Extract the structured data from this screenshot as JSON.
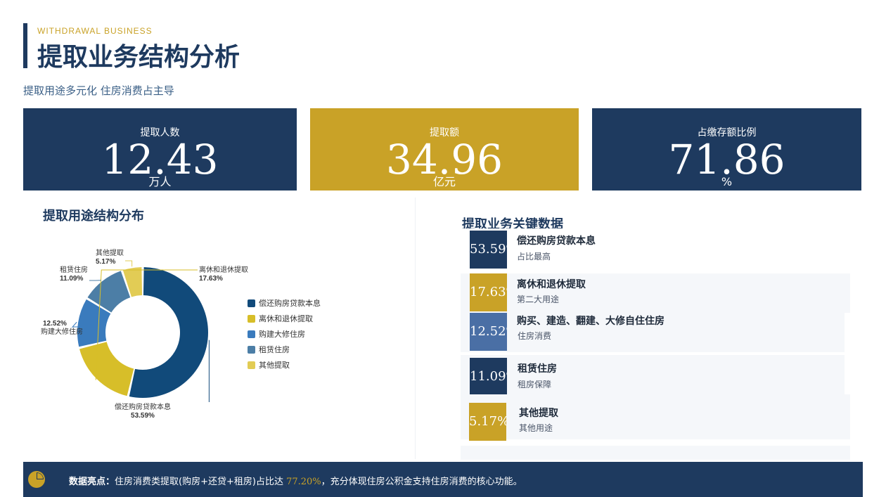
{
  "header": {
    "eyebrow": "WITHDRAWAL BUSINESS",
    "title": "提取业务结构分析",
    "subtitle": "提取用途多元化 住房消费占主导"
  },
  "kpis": [
    {
      "label": "提取人数",
      "value": "12.43",
      "unit": "万人",
      "color": "#1e3a5f"
    },
    {
      "label": "提取额",
      "value": "34.96",
      "unit": "亿元",
      "color": "#c9a227"
    },
    {
      "label": "占缴存额比例",
      "value": "71.86",
      "unit": "%",
      "color": "#1e3a5f"
    }
  ],
  "structure": {
    "title": "提取用途结构分布"
  },
  "chart_data": {
    "type": "pie",
    "variant": "donut",
    "categories": [
      "偿还购房贷款本息",
      "离休和退休提取",
      "购建大修住房",
      "租赁住房",
      "其他提取"
    ],
    "values": [
      53.59,
      17.63,
      12.52,
      11.09,
      5.17
    ],
    "value_labels": [
      "53.59%",
      "17.63%",
      "12.52%",
      "11.09%",
      "5.17%"
    ],
    "colors": [
      "#114a7a",
      "#d7be29",
      "#3a7bbd",
      "#4c7ea6",
      "#e2cc55"
    ],
    "slice_labels": [
      {
        "name": "偿还购房贷款本息",
        "value": "53.59%"
      },
      {
        "name": "离休和退休提取",
        "value": "17.63%"
      },
      {
        "name": "购建大修住房",
        "value": "12.52%"
      },
      {
        "name": "租赁住房",
        "value": "11.09%"
      },
      {
        "name": "其他提取",
        "value": "5.17%"
      }
    ],
    "legend": "right"
  },
  "key_data": {
    "title": "提取业务关键数据",
    "items": [
      {
        "badge": "53.59%",
        "title": "偿还购房贷款本息",
        "sub": "占比最高",
        "color": "#1e3a5f"
      },
      {
        "badge": "17.63%",
        "title": "离休和退休提取",
        "sub": "第二大用途",
        "color": "#c9a227"
      },
      {
        "badge": "12.52%",
        "title": "购买、建造、翻建、大修自住住房",
        "sub": "住房消费",
        "color": "#4a6fa5"
      },
      {
        "badge": "11.09%",
        "title": "租赁住房",
        "sub": "租房保障",
        "color": "#1e3a5f"
      },
      {
        "badge": "5.17%",
        "title": "其他提取",
        "sub": "其他用途",
        "color": "#c9a227"
      }
    ]
  },
  "footer": {
    "icon": "pie-chart-icon",
    "lead": "数据亮点：",
    "text_before": "住房消费类提取(购房+还贷+租房)占比达 ",
    "highlight": "77.20%",
    "text_after": "，充分体现住房公积金支持住房消费的核心功能。"
  }
}
